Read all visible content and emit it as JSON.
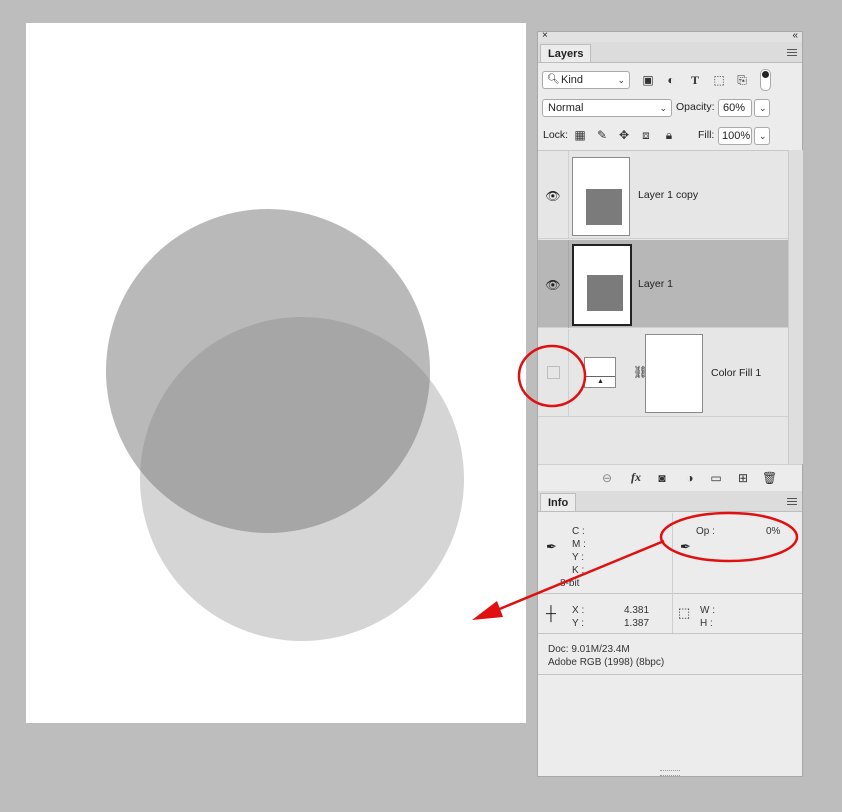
{
  "canvas": {
    "background": "#ffffff",
    "circle_top_color": "rgba(128,128,128,0.55)",
    "circle_bottom_color": "rgba(128,128,128,0.35)"
  },
  "layers_panel": {
    "tab_label": "Layers",
    "filter_kind": "Kind",
    "blend_mode": "Normal",
    "opacity_label": "Opacity:",
    "opacity_value": "60%",
    "lock_label": "Lock:",
    "fill_label": "Fill:",
    "fill_value": "100%",
    "layers": [
      {
        "name": "Layer 1 copy",
        "visible": true,
        "selected": false
      },
      {
        "name": "Layer 1",
        "visible": true,
        "selected": true
      },
      {
        "name": "Color Fill 1",
        "visible": false,
        "selected": false
      }
    ],
    "footer_icons": [
      "link-icon",
      "fx-icon",
      "mask-icon",
      "adjustment-icon",
      "folder-icon",
      "new-layer-icon",
      "trash-icon"
    ],
    "fx_label": "fx"
  },
  "info_panel": {
    "tab_label": "Info",
    "cmyk": {
      "c": "C :",
      "m": "M :",
      "y": "Y :",
      "k": "K :",
      "bit": "8-bit"
    },
    "op_label": "Op :",
    "op_value": "0%",
    "x_label": "X :",
    "x_value": "4.381",
    "y_label": "Y :",
    "y_value": "1.387",
    "w_label": "W :",
    "h_label": "H :",
    "doc_line": "Doc: 9.01M/23.4M",
    "profile_line": "Adobe RGB (1998) (8bpc)"
  },
  "annotations": {
    "color": "#e01010"
  }
}
